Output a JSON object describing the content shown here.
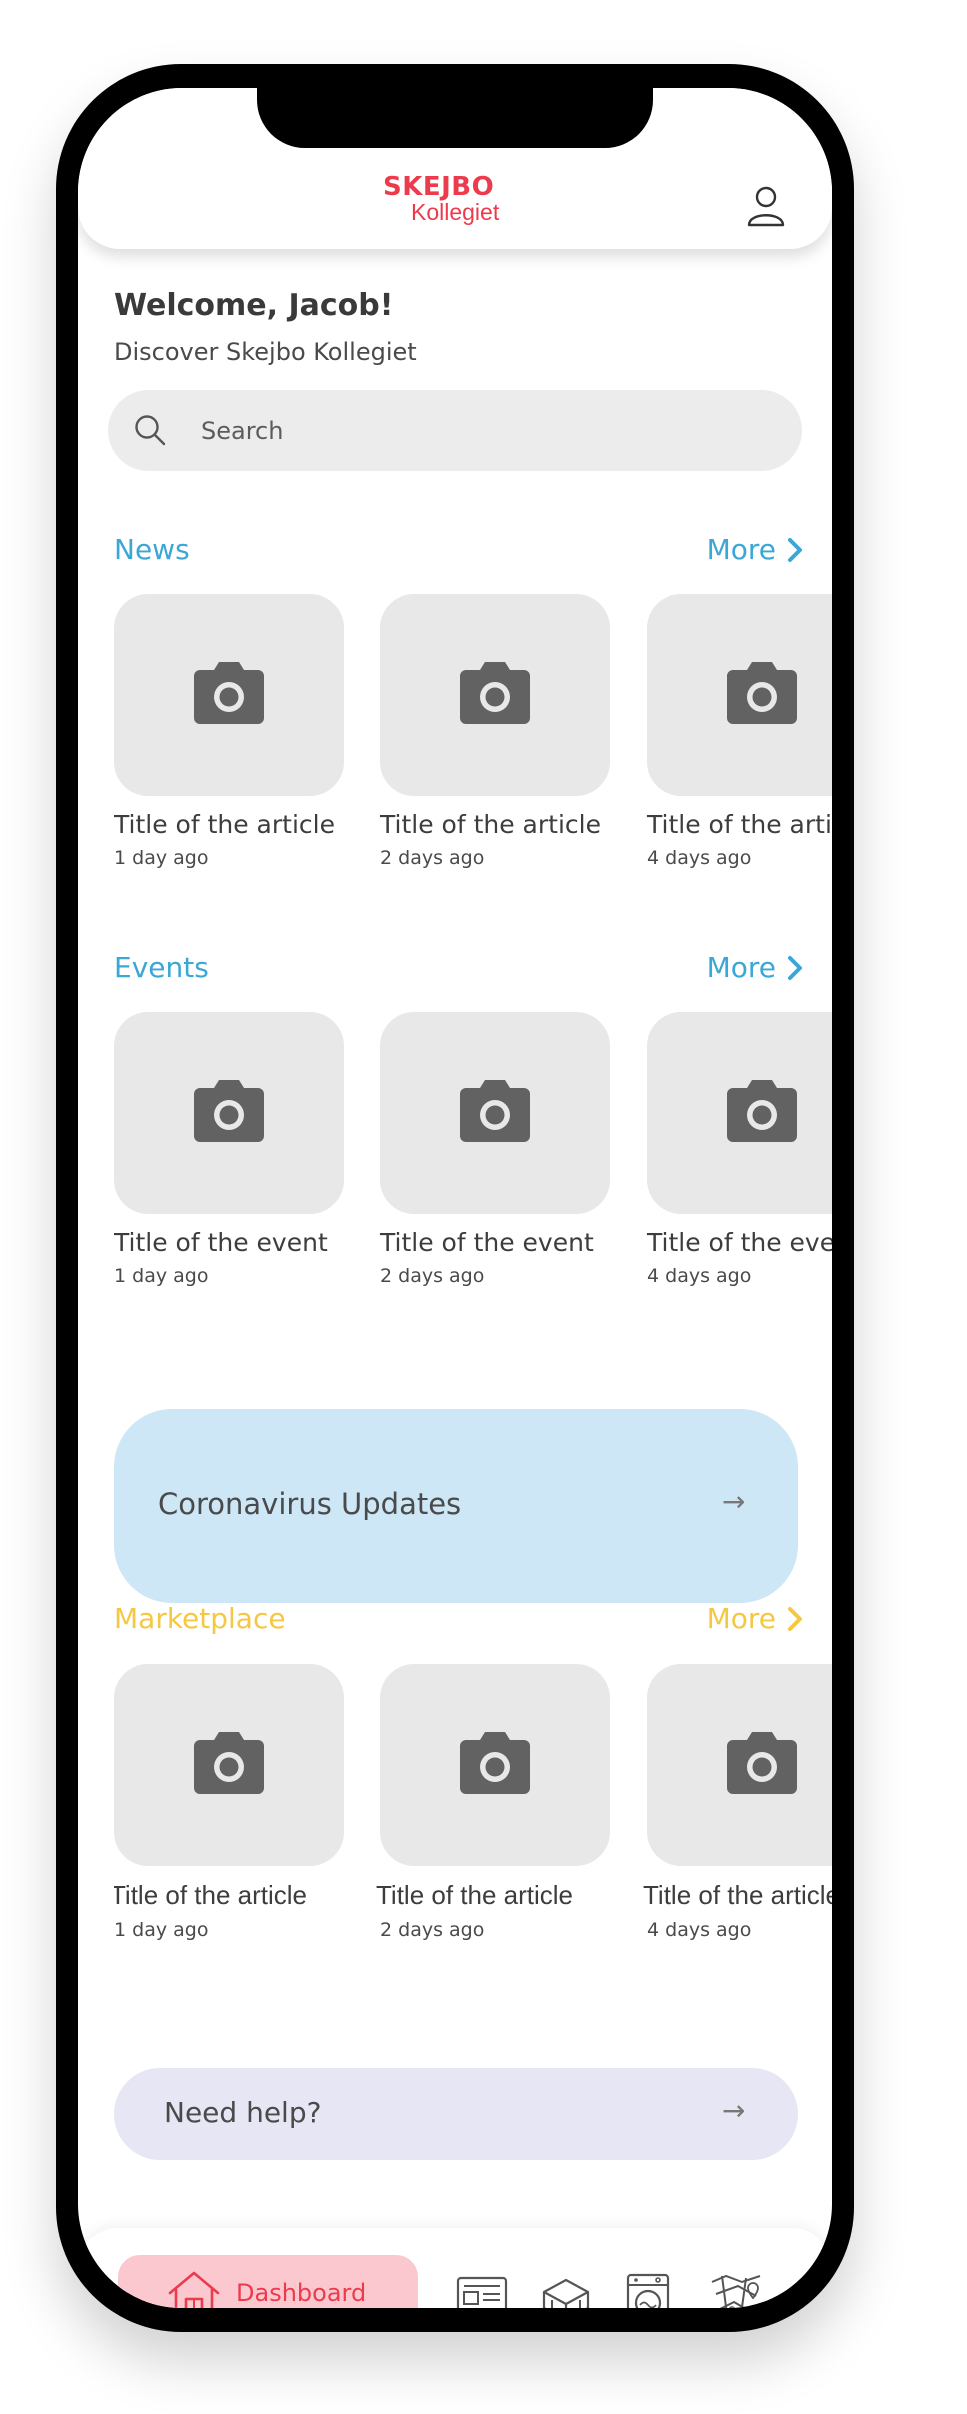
{
  "header": {
    "logo_top": "SKEJBO",
    "logo_bottom": "Kollegiet"
  },
  "welcome": {
    "greeting": "Welcome, Jacob!",
    "subtitle": "Discover Skejbo Kollegiet"
  },
  "search": {
    "placeholder": "Search"
  },
  "news": {
    "title": "News",
    "more_label": "More",
    "color": "#3aa7d6",
    "items": [
      {
        "title": "Title of the article",
        "time": "1 day ago"
      },
      {
        "title": "Title of the article",
        "time": "2 days ago"
      },
      {
        "title": "Title of the article",
        "time": "4 days ago"
      }
    ]
  },
  "events": {
    "title": "Events",
    "more_label": "More",
    "color": "#3aa7d6",
    "items": [
      {
        "title": "Title of the event",
        "time": "1 day ago"
      },
      {
        "title": "Title of the event",
        "time": "2 days ago"
      },
      {
        "title": "Title of the event",
        "time": "4 days ago"
      }
    ]
  },
  "corona_banner": {
    "label": "Coronavirus Updates",
    "arrow": "→",
    "color": "#cde7f6"
  },
  "marketplace": {
    "title": "Marketplace",
    "more_label": "More",
    "color": "#f5c842",
    "items": [
      {
        "title": "Title of the article",
        "time": "1 day ago"
      },
      {
        "title": "Title of the article",
        "time": "2 days ago"
      },
      {
        "title": "Title of the article",
        "time": "4 days ago"
      }
    ]
  },
  "help_banner": {
    "label": "Need help?",
    "arrow": "→",
    "color": "#e6e6f5"
  },
  "bottom_nav": {
    "active_label": "Dashboard",
    "accent": "#ec3b4c",
    "icons": [
      "house-icon",
      "newspaper-icon",
      "furniture-icon",
      "washing-machine-icon",
      "map-icon"
    ]
  }
}
